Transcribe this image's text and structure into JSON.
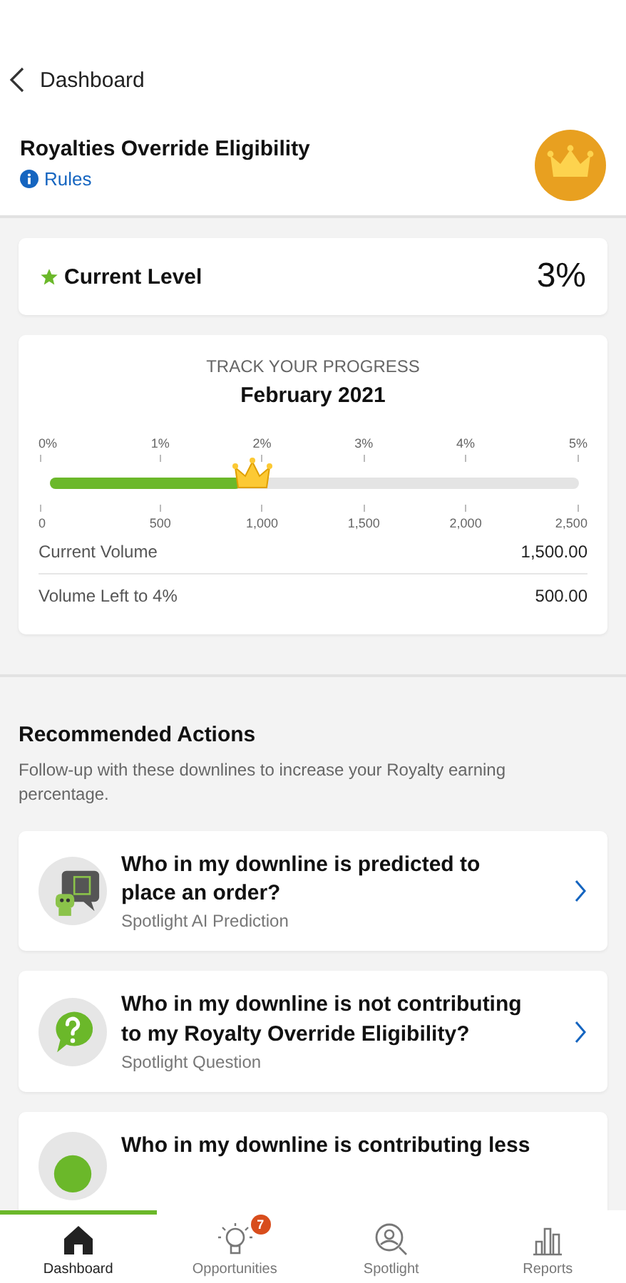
{
  "back": {
    "label": "Dashboard"
  },
  "header": {
    "title": "Royalties Override Eligibility",
    "rules_link": "Rules"
  },
  "current_level": {
    "label": "Current Level",
    "value": "3%"
  },
  "progress": {
    "heading": "TRACK YOUR PROGRESS",
    "period": "February 2021",
    "level": 0.36,
    "percent_ticks": [
      "0%",
      "1%",
      "2%",
      "3%",
      "4%",
      "5%"
    ],
    "volume_ticks": [
      "0",
      "500",
      "1,000",
      "1,500",
      "2,000",
      "2,500"
    ],
    "rows": [
      {
        "label": "Current Volume",
        "value": "1,500.00"
      },
      {
        "label": "Volume Left to 4%",
        "value": "500.00"
      }
    ]
  },
  "recommended": {
    "title": "Recommended Actions",
    "description": "Follow-up with these downlines to increase your Royalty earning percentage.",
    "actions": [
      {
        "kind": "ai",
        "title": "Who in my downline is predicted to place an order?",
        "subtitle": "Spotlight AI Prediction"
      },
      {
        "kind": "question",
        "title": "Who in my downline is not contributing to my Royalty Override Eligibility?",
        "subtitle": "Spotlight Question"
      },
      {
        "kind": "partial",
        "title": "Who in my downline is contributing less"
      }
    ]
  },
  "tab_bar": [
    {
      "kind": "home",
      "label": "Dashboard",
      "selected": true
    },
    {
      "kind": "bulb",
      "label": "Opportunities",
      "selected": false,
      "badge": "7"
    },
    {
      "kind": "spotlight",
      "label": "Spotlight",
      "selected": false
    },
    {
      "kind": "reports",
      "label": "Reports",
      "selected": false
    }
  ]
}
